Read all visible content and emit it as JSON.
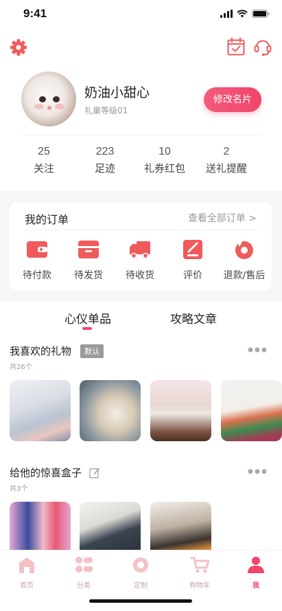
{
  "status_bar": {
    "time": "9:41"
  },
  "profile": {
    "nickname": "奶油小甜心",
    "level": "礼巢等级01",
    "edit_button": "修改名片"
  },
  "stats": [
    {
      "value": "25",
      "label": "关注"
    },
    {
      "value": "223",
      "label": "足迹"
    },
    {
      "value": "10",
      "label": "礼券红包"
    },
    {
      "value": "2",
      "label": "送礼提醒"
    }
  ],
  "orders": {
    "title": "我的订单",
    "view_all": "查看全部订单 >",
    "items": [
      {
        "label": "待付款",
        "icon": "wallet-icon"
      },
      {
        "label": "待发货",
        "icon": "box-icon"
      },
      {
        "label": "待收货",
        "icon": "truck-icon"
      },
      {
        "label": "评价",
        "icon": "review-icon"
      },
      {
        "label": "退款/售后",
        "icon": "refund-icon"
      }
    ]
  },
  "tabs": [
    {
      "label": "心仪单品",
      "active": true
    },
    {
      "label": "攻略文章",
      "active": false
    }
  ],
  "favorites": {
    "title": "我喜欢的礼物",
    "badge": "默认",
    "count": "共26个"
  },
  "surprise_box": {
    "title": "给他的惊喜盒子",
    "count": "共3个"
  },
  "bottom_nav": [
    {
      "label": "首页",
      "icon": "home-icon",
      "active": false
    },
    {
      "label": "分类",
      "icon": "category-icon",
      "active": false
    },
    {
      "label": "定制",
      "icon": "customize-icon",
      "active": false
    },
    {
      "label": "购物车",
      "icon": "cart-icon",
      "active": false
    },
    {
      "label": "我",
      "icon": "user-icon",
      "active": true
    }
  ],
  "colors": {
    "accent": "#f0466a",
    "icon_red": "#f05a5a",
    "nav_inactive": "#f3c1c6"
  }
}
